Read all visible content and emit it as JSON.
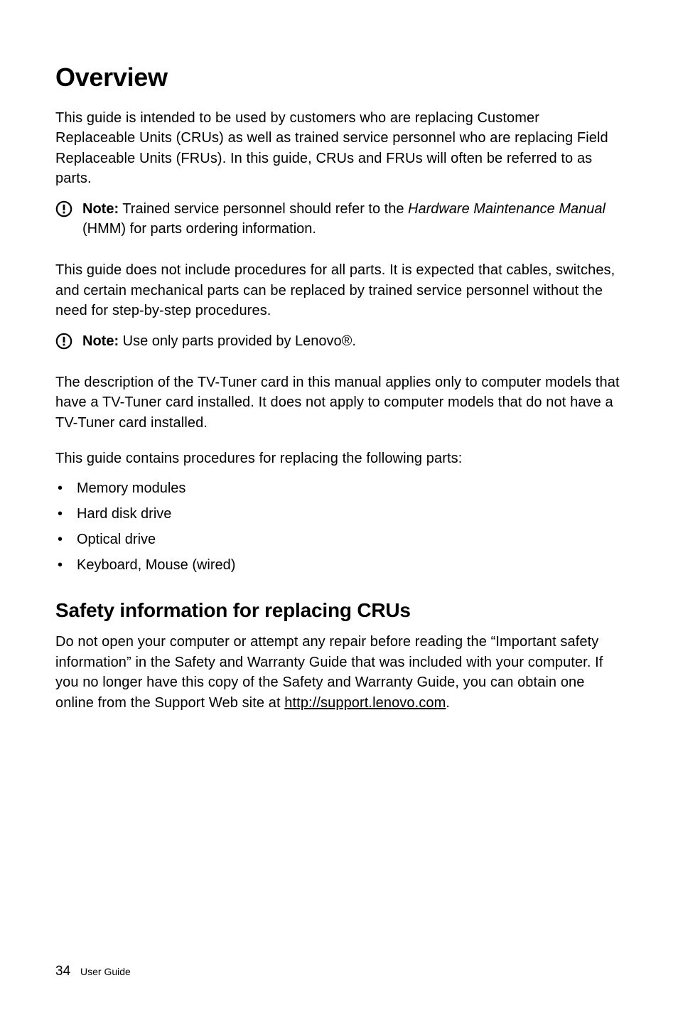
{
  "heading1": "Overview",
  "intro_para": "This guide is intended to be used by customers who are replacing Customer Replaceable Units (CRUs) as well as trained service personnel who are replacing Field Replaceable Units (FRUs). In this guide, CRUs and FRUs will often be referred to as parts.",
  "note1": {
    "label": "Note:",
    "text_before_italic": " Trained service personnel should refer to the ",
    "italic": "Hardware Maintenance Manual",
    "text_after_italic": " (HMM) for parts ordering information."
  },
  "para2": "This guide does not include procedures for all parts. It is expected that cables, switches, and certain mechanical parts can be replaced by trained service personnel without the need for step-by-step procedures.",
  "note2": {
    "label": "Note:",
    "text": " Use only parts provided by Lenovo®."
  },
  "para3": "The description of the TV-Tuner card in this manual applies only to computer models that have a TV-Tuner card installed. It does not apply to computer models that do not have a TV-Tuner card installed.",
  "para4": "This guide contains procedures for replacing the following parts:",
  "parts_list": [
    "Memory modules",
    "Hard disk drive",
    "Optical drive",
    "Keyboard, Mouse (wired)"
  ],
  "heading2": "Safety information for replacing CRUs",
  "safety_para_before_link": "Do not open your computer or attempt any repair before reading the “Important safety information” in the Safety and Warranty Guide that was included with your computer. If you no longer have this copy of the Safety and Warranty Guide, you can obtain one online from the Support Web site at ",
  "safety_link": "http://support.lenovo.com",
  "safety_para_after_link": ".",
  "footer": {
    "page_number": "34",
    "label": "User Guide"
  }
}
